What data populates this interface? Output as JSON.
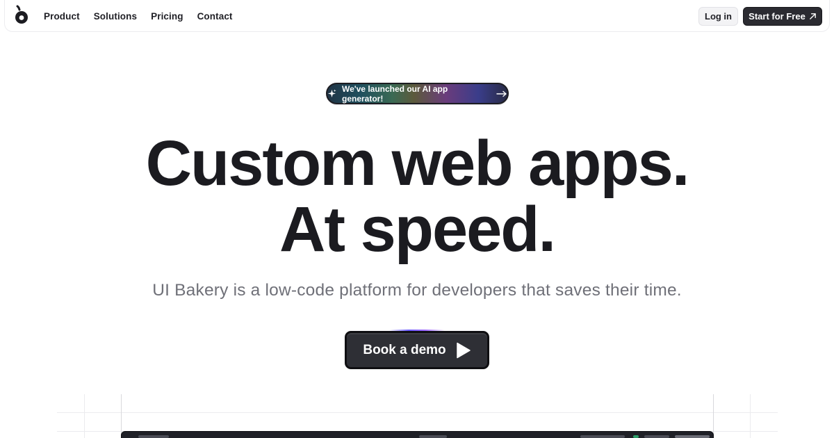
{
  "header": {
    "logo_icon": "ui-bakery-logo-icon",
    "nav": [
      {
        "label": "Product"
      },
      {
        "label": "Solutions"
      },
      {
        "label": "Pricing"
      },
      {
        "label": "Contact"
      }
    ],
    "login_label": "Log in",
    "start_label": "Start for Free",
    "start_icon": "arrow-up-right-icon"
  },
  "announcement": {
    "text": "We've launched our AI app generator!",
    "leading_icon": "sparkle-icon",
    "trailing_icon": "arrow-right-icon"
  },
  "hero": {
    "title_line1": "Custom web apps.",
    "title_line2": "At speed.",
    "subtitle": "UI Bakery is a low-code platform for developers that saves their time.",
    "cta_label": "Book a demo",
    "cta_icon": "play-icon"
  },
  "colors": {
    "text_dark": "#1b1b20",
    "subtitle_gray": "#6f7078",
    "button_dark": "#2e2f35"
  }
}
